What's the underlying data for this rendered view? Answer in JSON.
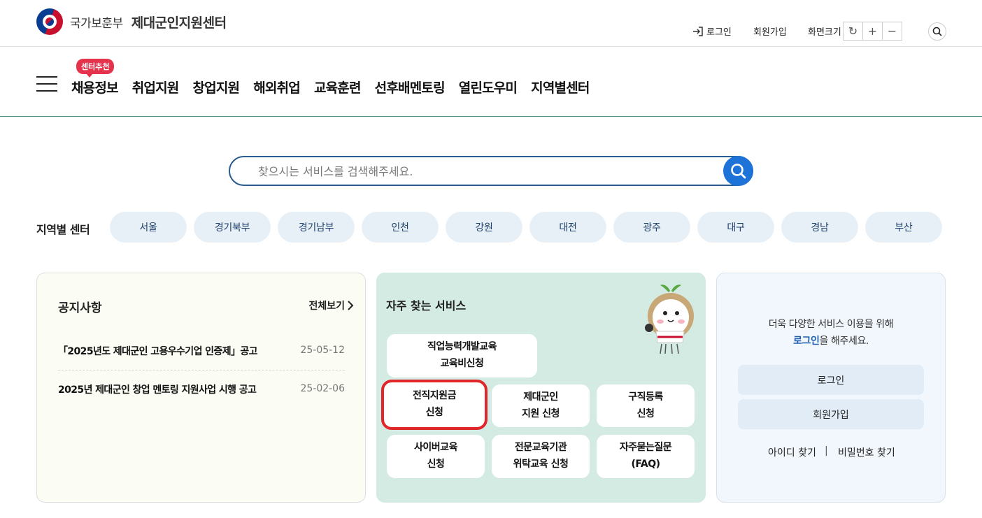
{
  "header": {
    "org_name": "국가보훈부",
    "site_name": "제대군인지원센터",
    "login": "로그인",
    "join": "회원가입",
    "zoom_label": "화면크기",
    "zoom_reset": "↻",
    "zoom_in": "+",
    "zoom_out": "−"
  },
  "gnb": {
    "badge": "센터추천",
    "items": [
      "채용정보",
      "취업지원",
      "창업지원",
      "해외취업",
      "교육훈련",
      "선후배멘토링",
      "열린도우미",
      "지역별센터"
    ]
  },
  "search": {
    "placeholder": "찾으시는 서비스를 검색해주세요."
  },
  "regions": {
    "label": "지역별 센터",
    "items": [
      "서울",
      "경기북부",
      "경기남부",
      "인천",
      "강원",
      "대전",
      "광주",
      "대구",
      "경남",
      "부산"
    ]
  },
  "notice": {
    "title": "공지사항",
    "more": "전체보기",
    "items": [
      {
        "title": "「2025년도 제대군인 고용우수기업 인증제」공고",
        "date": "25-05-12"
      },
      {
        "title": "2025년 제대군인 창업 멘토링 지원사업 시행 공고",
        "date": "25-02-06"
      }
    ]
  },
  "services": {
    "title": "자주 찾는 서비스",
    "items": [
      {
        "line1": "직업능력개발교육",
        "line2": "교육비신청"
      },
      {
        "line1": "전직지원금",
        "line2": "신청"
      },
      {
        "line1": "제대군인",
        "line2": "지원 신청"
      },
      {
        "line1": "구직등록",
        "line2": "신청"
      },
      {
        "line1": "사이버교육",
        "line2": "신청"
      },
      {
        "line1": "전문교육기관",
        "line2": "위탁교육 신청"
      },
      {
        "line1": "자주묻는질문",
        "line2": "(FAQ)"
      }
    ]
  },
  "member": {
    "msg_line1": "더욱 다양한 서비스 이용을 위해",
    "msg_login": "로그인",
    "msg_line2_rest": "을 해주세요.",
    "login_button": "로그인",
    "join_button": "회원가입",
    "find_id": "아이디 찾기",
    "separator": "|",
    "find_pw": "비밀번호 찾기"
  },
  "colors": {
    "accent": "#1e73d8",
    "highlight": "#e0262b",
    "badge": "#e5334d",
    "service_panel": "#d3ebe3"
  }
}
